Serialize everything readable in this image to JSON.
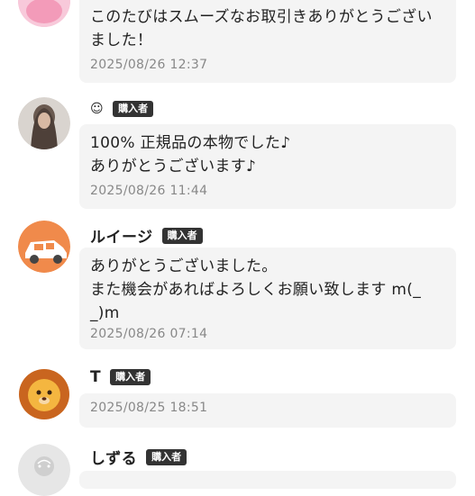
{
  "reviews": [
    {
      "username": "",
      "badge": "",
      "message": "このたびはスムーズなお取引きありがとうござい\nました！",
      "date": "2025/08/26 12:37",
      "avatar_icon": "pink-character-avatar-icon"
    },
    {
      "username": "☺",
      "badge": "購入者",
      "message": "100% 正規品の本物でした♪\nありがとうございます♪",
      "date": "2025/08/26 11:44",
      "avatar_icon": "long-hair-person-avatar-icon"
    },
    {
      "username": "ルイージ",
      "badge": "購入者",
      "message": "ありがとうございました。\nまた機会があればよろしくお願い致します m(_\n_)m",
      "date": "2025/08/26 07:14",
      "avatar_icon": "orange-car-avatar-icon"
    },
    {
      "username": "T",
      "badge": "購入者",
      "message": "",
      "date": "2025/08/25 18:51",
      "avatar_icon": "lion-emoji-avatar-icon"
    },
    {
      "username": "しずる",
      "badge": "購入者",
      "message": "",
      "date": "",
      "avatar_icon": "default-user-avatar-icon"
    }
  ]
}
